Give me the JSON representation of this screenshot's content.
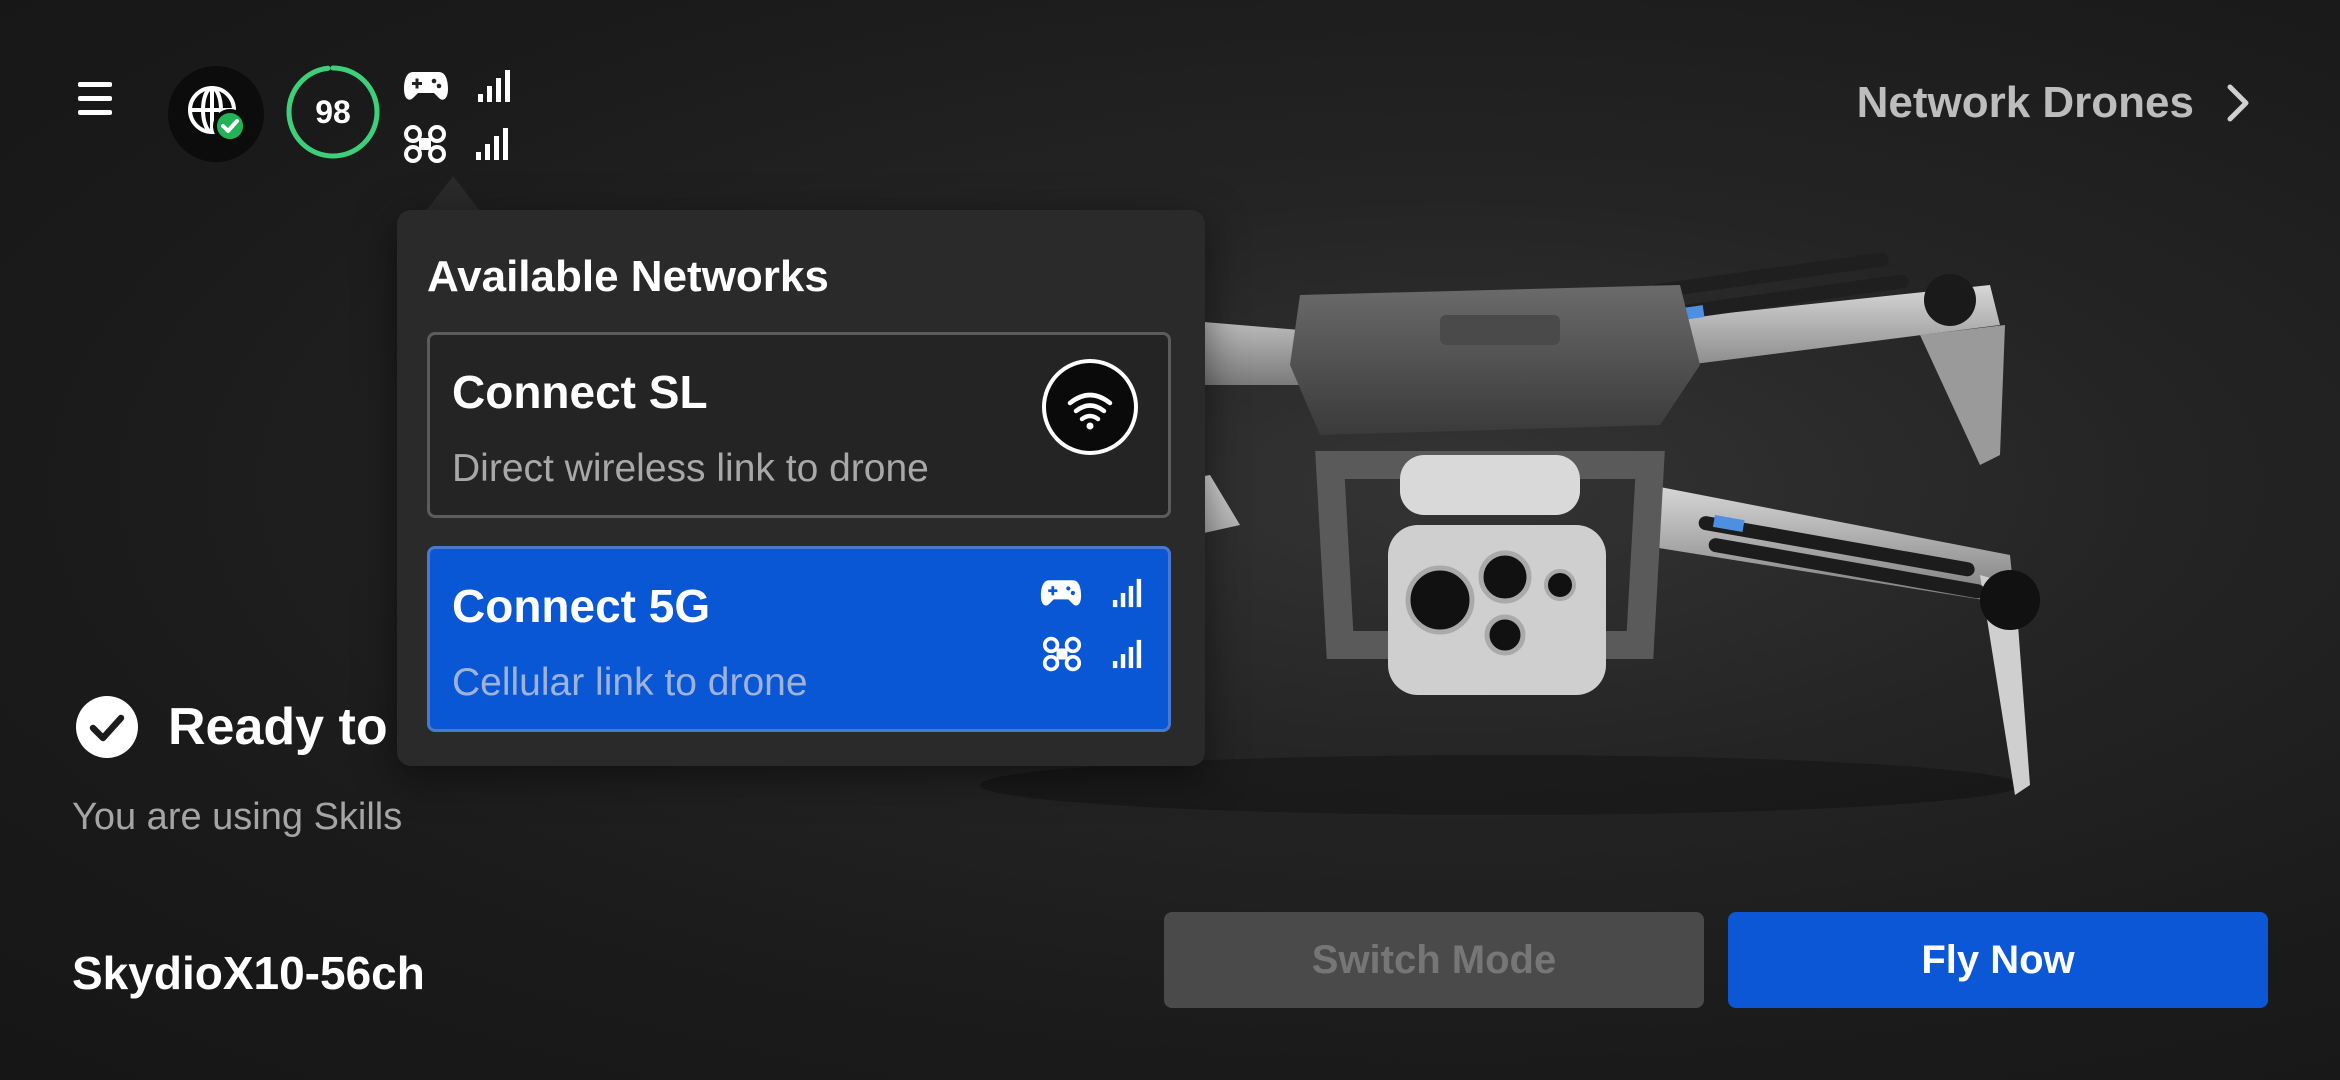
{
  "header": {
    "battery_percent": 98,
    "battery_label": "98",
    "network_drones_label": "Network Drones"
  },
  "popover": {
    "title": "Available Networks",
    "networks": [
      {
        "name": "Connect SL",
        "description": "Direct wireless link to drone",
        "icon": "wifi-icon",
        "selected": false
      },
      {
        "name": "Connect 5G",
        "description": "Cellular link to drone",
        "icon": "cellular-signal-icon",
        "selected": true
      }
    ]
  },
  "status": {
    "ready_text": "Ready to",
    "sub_text": "You are using Skills",
    "drone_name": "SkydioX10-56ch"
  },
  "actions": {
    "switch_mode_label": "Switch Mode",
    "fly_now_label": "Fly Now"
  },
  "colors": {
    "accent": "#0b57d6",
    "ready_ring": "#3ecf7a",
    "background": "#1c1c1c"
  }
}
